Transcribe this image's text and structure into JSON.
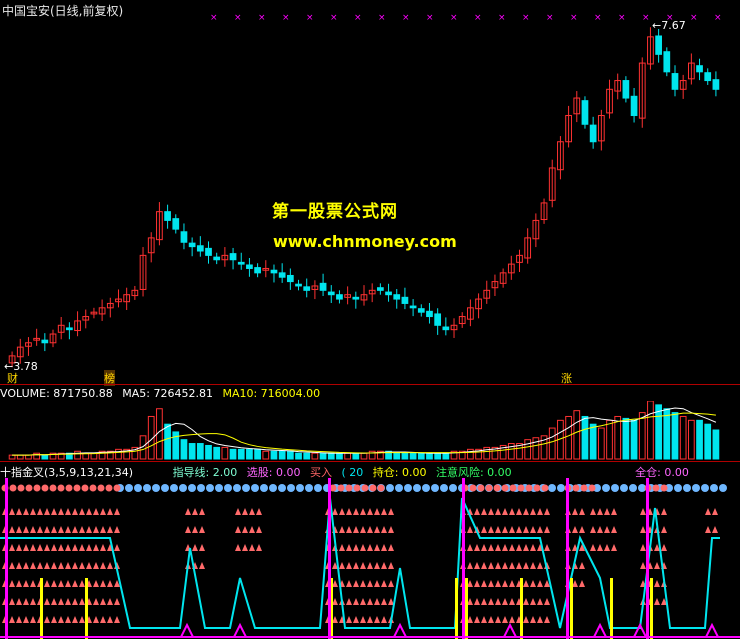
{
  "window": {
    "title": "中国宝安(日线,前复权)"
  },
  "watermark": {
    "line1": "第一股票公式网",
    "line2": "www.chnmoney.com"
  },
  "markers": {
    "low_label": "3.78",
    "high_label": "7.67",
    "badge_cai": "财",
    "badge_bang": "榜",
    "badge_zhang": "涨"
  },
  "volume_panel": {
    "vol_label": "VOLUME: 871750.88",
    "ma5_label": "MA5: 726452.81",
    "ma10_label": "MA10: 716004.00"
  },
  "indicator_panel": {
    "name": "十指金叉(3,5,9,13,21,34)",
    "guide": "指导线: 2.00",
    "pick": "选股: 0.00",
    "buy": "买入",
    "hold_prefix": "( 20",
    "hold": "持仓: 0.00",
    "risk": "注意风险: 0.00",
    "full": "全仓: 0.00"
  },
  "colors": {
    "up": "#ff3232",
    "down": "#00e5ee",
    "yellow": "#ffff00",
    "magenta": "#ff00ff",
    "white": "#ffffff",
    "arrow": "#ff6a6a",
    "ball": "#6fb7ff"
  },
  "chart_data": [
    {
      "type": "candlestick",
      "price_range": [
        3.78,
        7.67
      ],
      "low": 3.78,
      "high": 7.67,
      "series": [
        {
          "name": "close",
          "values": [
            3.85,
            3.95,
            4.0,
            4.05,
            4.0,
            4.1,
            4.2,
            4.15,
            4.25,
            4.3,
            4.35,
            4.4,
            4.45,
            4.5,
            4.55,
            4.6,
            5.0,
            5.2,
            5.5,
            5.4,
            5.3,
            5.15,
            5.1,
            5.05,
            5.0,
            4.95,
            5.0,
            4.95,
            4.9,
            4.85,
            4.8,
            4.85,
            4.8,
            4.75,
            4.7,
            4.65,
            4.6,
            4.65,
            4.6,
            4.55,
            4.5,
            4.55,
            4.5,
            4.55,
            4.6,
            4.6,
            4.55,
            4.5,
            4.45,
            4.4,
            4.35,
            4.3,
            4.2,
            4.15,
            4.2,
            4.3,
            4.4,
            4.5,
            4.6,
            4.7,
            4.8,
            4.9,
            5.0,
            5.2,
            5.4,
            5.6,
            6.0,
            6.3,
            6.6,
            6.8,
            6.5,
            6.3,
            6.6,
            6.9,
            7.0,
            6.8,
            6.6,
            7.2,
            7.5,
            7.3,
            7.1,
            6.9,
            7.0,
            7.2,
            7.1,
            7.0,
            6.9
          ]
        }
      ]
    },
    {
      "type": "bar",
      "title": "VOLUME",
      "series": [
        {
          "name": "VOLUME",
          "values": [
            2,
            2,
            2,
            3,
            2,
            3,
            3,
            3,
            4,
            3,
            3,
            4,
            4,
            5,
            5,
            6,
            12,
            22,
            26,
            18,
            14,
            10,
            8,
            8,
            7,
            6,
            6,
            5,
            5,
            5,
            5,
            4,
            4,
            4,
            4,
            3,
            3,
            3,
            3,
            3,
            3,
            3,
            3,
            3,
            4,
            4,
            4,
            3,
            3,
            3,
            3,
            3,
            3,
            3,
            4,
            4,
            5,
            5,
            6,
            6,
            7,
            8,
            8,
            10,
            11,
            12,
            16,
            20,
            22,
            25,
            22,
            18,
            16,
            20,
            22,
            21,
            20,
            24,
            30,
            28,
            26,
            24,
            22,
            20,
            20,
            18,
            15
          ]
        }
      ]
    }
  ]
}
